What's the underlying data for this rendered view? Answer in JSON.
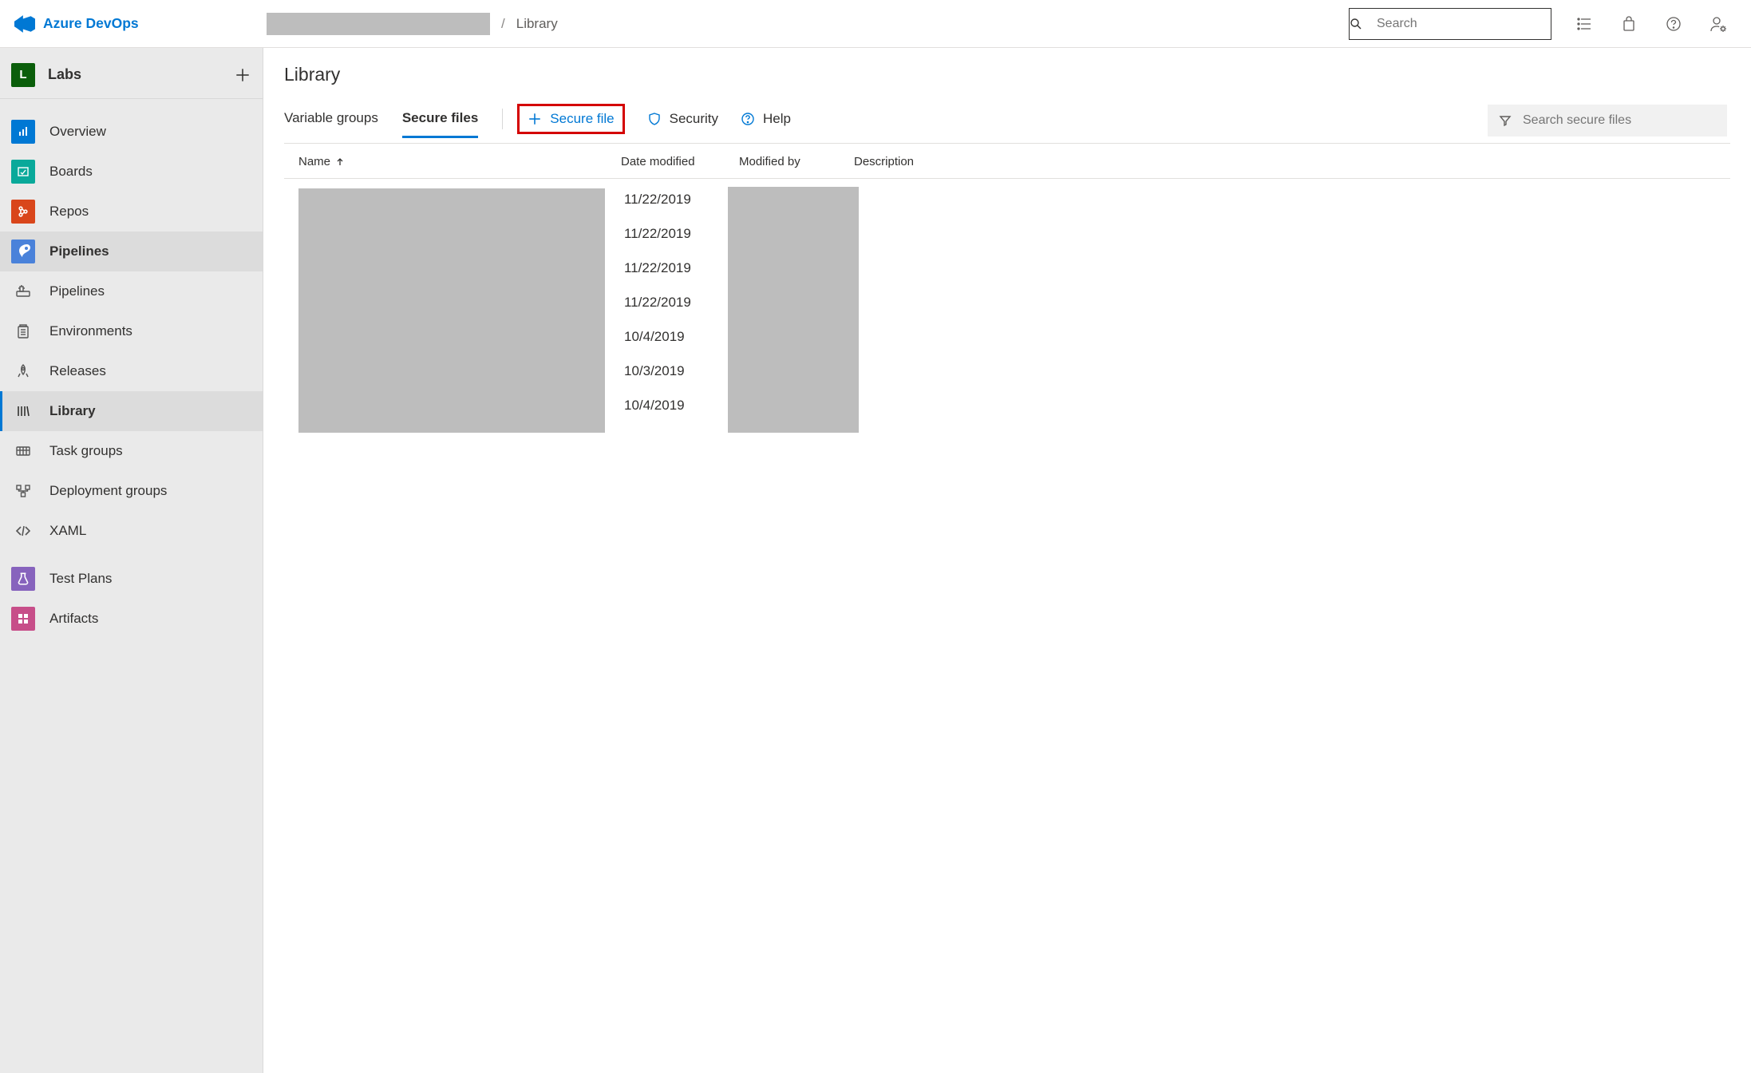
{
  "brand": "Azure DevOps",
  "breadcrumb": {
    "current": "Library"
  },
  "search": {
    "placeholder": "Search"
  },
  "project": {
    "letter": "L",
    "name": "Labs"
  },
  "sidebar": {
    "overview": "Overview",
    "boards": "Boards",
    "repos": "Repos",
    "pipelines": "Pipelines",
    "pipelines_sub": "Pipelines",
    "environments": "Environments",
    "releases": "Releases",
    "library": "Library",
    "task_groups": "Task groups",
    "deployment_groups": "Deployment groups",
    "xaml": "XAML",
    "test_plans": "Test Plans",
    "artifacts": "Artifacts"
  },
  "page": {
    "title": "Library"
  },
  "tabs": {
    "variable_groups": "Variable groups",
    "secure_files": "Secure files"
  },
  "toolbar": {
    "add_secure_file": "Secure file",
    "security": "Security",
    "help": "Help",
    "filter_placeholder": "Search secure files"
  },
  "columns": {
    "name": "Name",
    "date_modified": "Date modified",
    "modified_by": "Modified by",
    "description": "Description"
  },
  "rows": [
    {
      "date": "11/22/2019"
    },
    {
      "date": "11/22/2019"
    },
    {
      "date": "11/22/2019"
    },
    {
      "date": "11/22/2019"
    },
    {
      "date": "10/4/2019"
    },
    {
      "date": "10/3/2019"
    },
    {
      "date": "10/4/2019"
    }
  ]
}
